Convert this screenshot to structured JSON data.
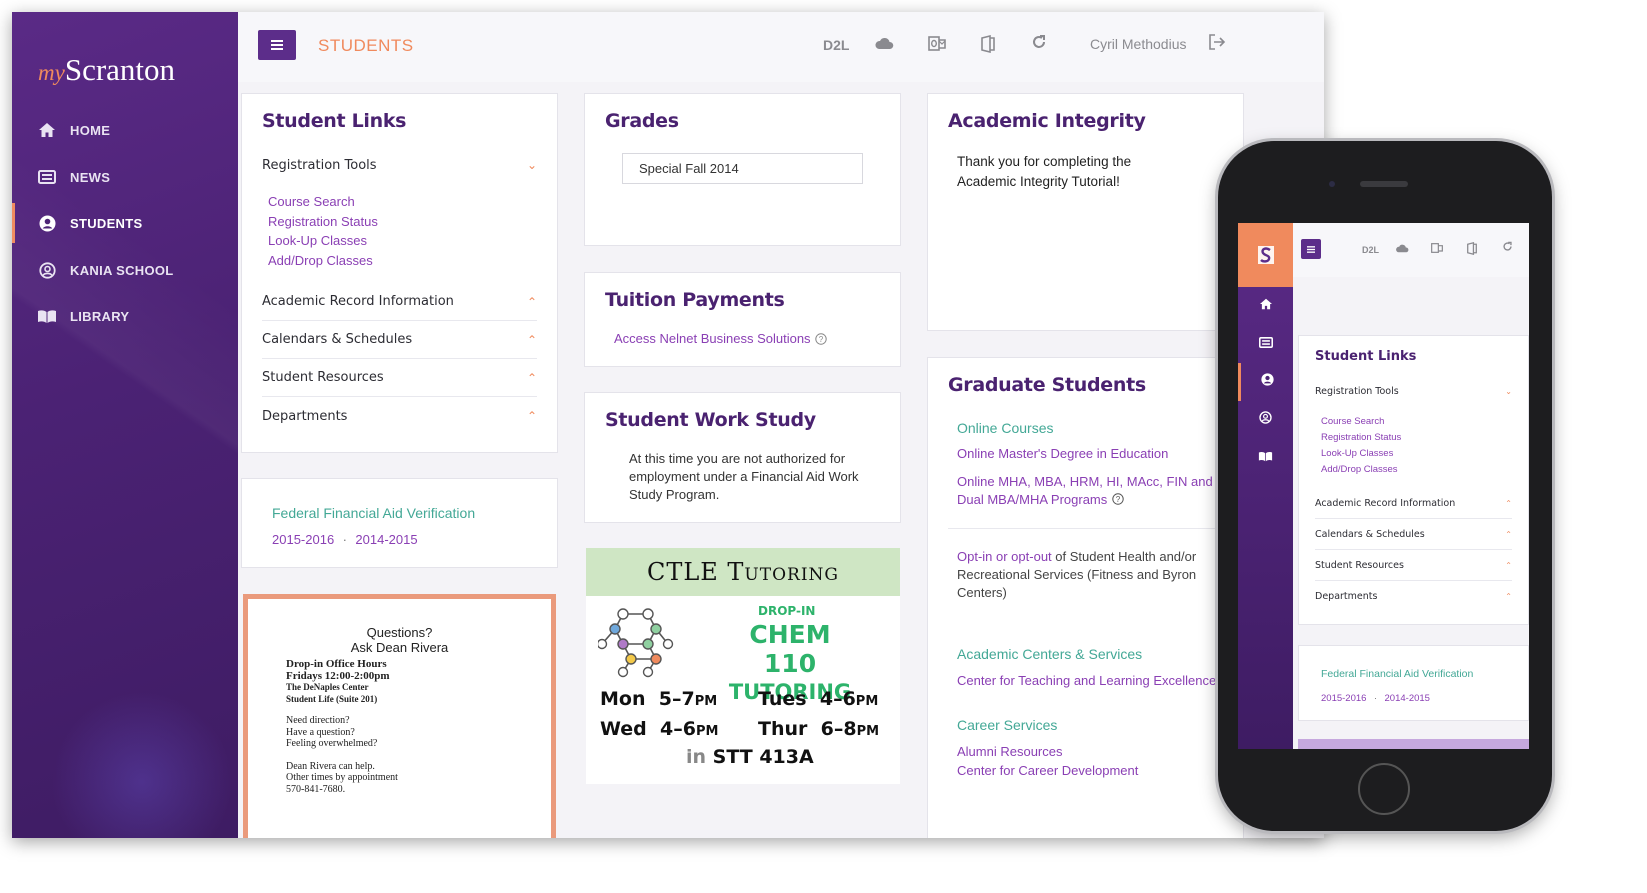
{
  "app": {
    "logo_my": "my",
    "logo_name": "Scranton",
    "page_title": "STUDENTS",
    "user_name": "Cyril Methodius",
    "toolbar": {
      "d2l": "D2L"
    }
  },
  "sidebar": {
    "items": [
      {
        "label": "HOME"
      },
      {
        "label": "NEWS"
      },
      {
        "label": "STUDENTS"
      },
      {
        "label": "KANIA SCHOOL"
      },
      {
        "label": "LIBRARY"
      }
    ]
  },
  "student_links": {
    "title": "Student Links",
    "sections": [
      {
        "label": "Registration Tools"
      },
      {
        "label": "Academic Record Information"
      },
      {
        "label": "Calendars & Schedules"
      },
      {
        "label": "Student Resources"
      },
      {
        "label": "Departments"
      }
    ],
    "registration_links": [
      "Course Search",
      "Registration Status",
      "Look-Up Classes",
      "Add/Drop Classes"
    ]
  },
  "financial_aid": {
    "title": "Federal Financial Aid Verification",
    "year1": "2015-2016",
    "separator": "·",
    "year2": "2014-2015"
  },
  "flyer": {
    "line1": "Questions?",
    "line2": "Ask Dean Rivera",
    "hours_title": "Drop-in Office Hours",
    "hours_time": "Fridays 12:00-2:00pm",
    "place1": "The DeNaples Center",
    "place2": "Student Life (Suite 201)",
    "q1": "Need direction?",
    "q2": "Have a question?",
    "q3": "Feeling overwhelmed?",
    "help": "Dean Rivera can help.",
    "other": "Other times by appointment",
    "phone": "570-841-7680."
  },
  "grades": {
    "title": "Grades",
    "select_value": "Special Fall 2014"
  },
  "tuition": {
    "title": "Tuition Payments",
    "link": "Access Nelnet Business Solutions"
  },
  "work_study": {
    "title": "Student Work Study",
    "text": "At this time you are not authorized for employment under a Financial Aid Work Study Program."
  },
  "ctle": {
    "title": "CTLE Tutoring",
    "dropin": "DROP-IN",
    "course": "CHEM 110",
    "tutoring": "TUTORING",
    "mon": "Mon",
    "mon_time": "5–7",
    "mon_pm": "PM",
    "tues": "Tues",
    "tues_time": "4–6",
    "tues_pm": "PM",
    "wed": "Wed",
    "wed_time": "4–6",
    "wed_pm": "PM",
    "thur": "Thur",
    "thur_time": "6–8",
    "thur_pm": "PM",
    "in": "in",
    "room": "STT 413A"
  },
  "academic_integrity": {
    "title": "Academic Integrity",
    "text": "Thank you for completing the Academic Integrity Tutorial!"
  },
  "graduate": {
    "title": "Graduate Students",
    "online_courses": "Online Courses",
    "link1": "Online Master's Degree in Education",
    "link2": "Online MHA, MBA, HRM, HI, MAcc, FIN and Dual MBA/MHA Programs",
    "optin_link": "Opt-in or opt-out",
    "optin_text": " of Student Health and/or Recreational Services (Fitness and Byron Centers)",
    "centers_title": "Academic Centers & Services",
    "centers_link": "Center for Teaching and Learning Excellence",
    "career_title": "Career Services",
    "career_link1": "Alumni Resources",
    "career_link2": "Center for Career Development"
  },
  "mobile": {
    "d2l": "D2L",
    "title": "Student Links",
    "sections": [
      {
        "label": "Registration Tools"
      },
      {
        "label": "Academic Record Information"
      },
      {
        "label": "Calendars & Schedules"
      },
      {
        "label": "Student Resources"
      },
      {
        "label": "Departments"
      }
    ],
    "registration_links": [
      "Course Search",
      "Registration Status",
      "Look-Up Classes",
      "Add/Drop Classes"
    ],
    "fafsa_title": "Federal Financial Aid Verification",
    "year1": "2015-2016",
    "separator": "·",
    "year2": "2014-2015"
  },
  "colors": {
    "brand_purple": "#5c2d8a",
    "accent_orange": "#f08a5d",
    "link_purple": "#8a3fb4",
    "link_green": "#43a896"
  }
}
